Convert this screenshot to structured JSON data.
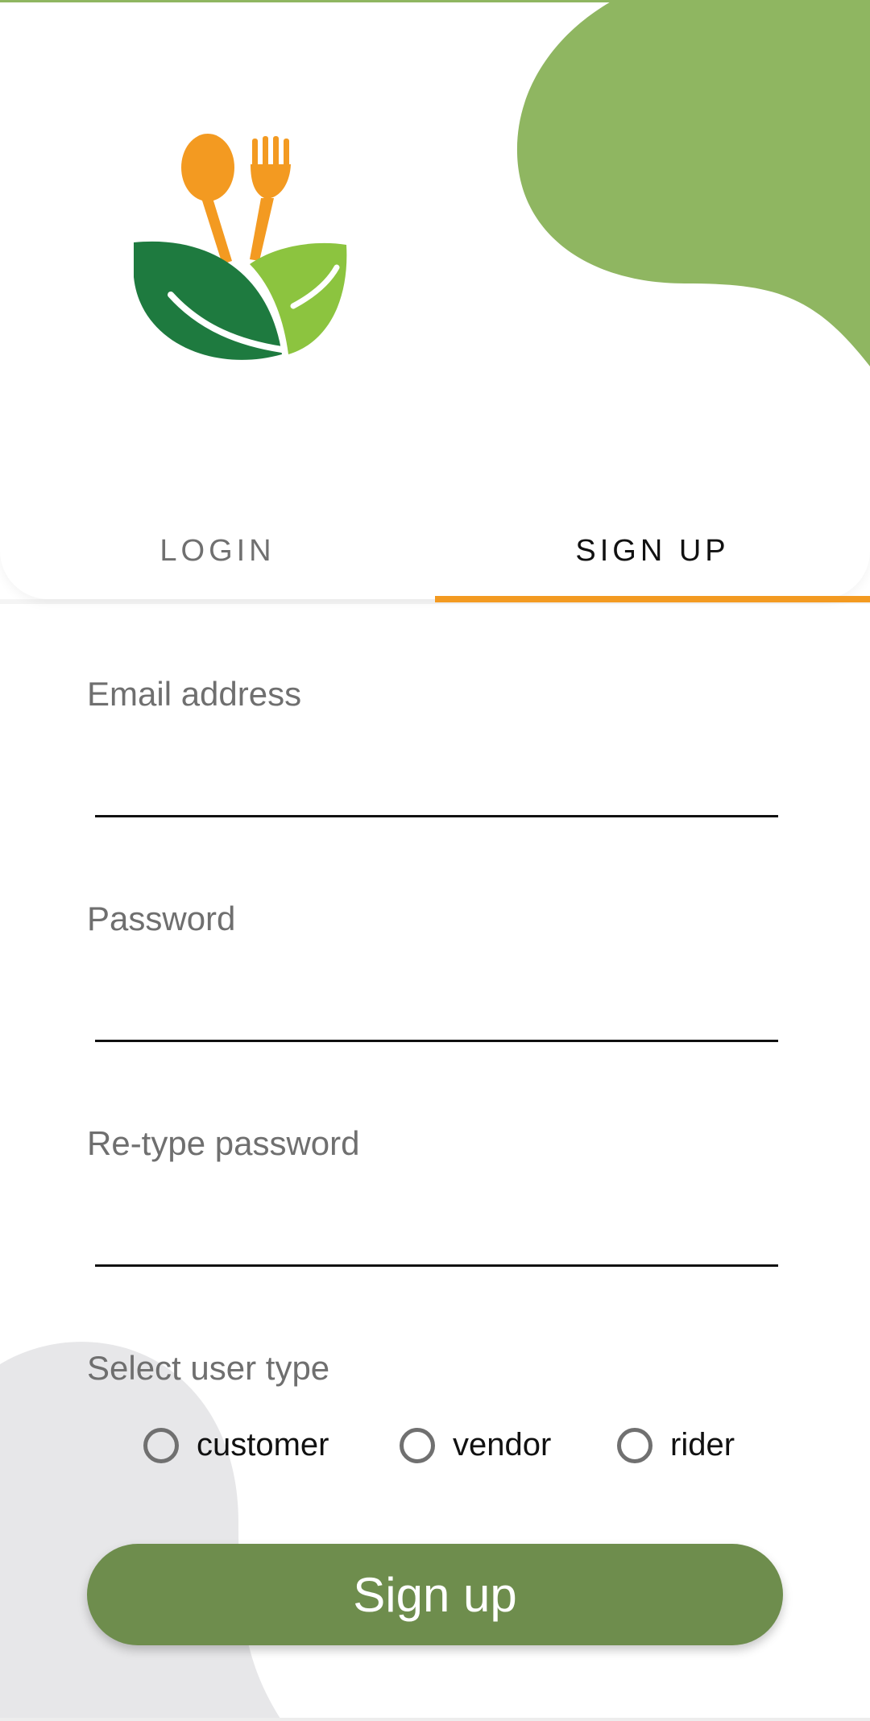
{
  "colors": {
    "accent_green": "#8fb661",
    "button_green": "#6e8d4d",
    "tab_indicator_orange": "#f39a21",
    "logo_orange": "#f39a21",
    "logo_dark_green": "#1e7a3f",
    "logo_light_green": "#8cc43f",
    "background_blob_grey": "#e7e7e9"
  },
  "logo": {
    "icon": "spoon-fork-leaves-logo"
  },
  "tabs": [
    {
      "label": "LOGIN",
      "active": false
    },
    {
      "label": "SIGN UP",
      "active": true
    }
  ],
  "form": {
    "email": {
      "label": "Email address",
      "value": ""
    },
    "password": {
      "label": "Password",
      "value": ""
    },
    "retype_password": {
      "label": "Re-type password",
      "value": ""
    },
    "user_type": {
      "label": "Select user type",
      "options": [
        "customer",
        "vendor",
        "rider"
      ],
      "selected": null
    },
    "submit_label": "Sign up"
  }
}
